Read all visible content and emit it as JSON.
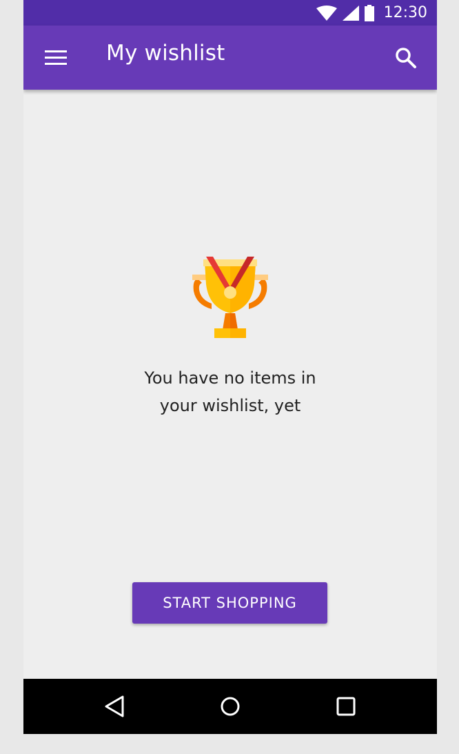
{
  "status_bar": {
    "time": "12:30",
    "icons": [
      "wifi-icon",
      "signal-icon",
      "battery-icon"
    ]
  },
  "app_bar": {
    "title": "My wishlist",
    "menu_icon": "menu-icon",
    "search_icon": "search-icon"
  },
  "empty_state": {
    "illustration": "trophy-icon",
    "line1": "You have no items in",
    "line2": "your wishlist, yet"
  },
  "actions": {
    "start_shopping_label": "START SHOPPING"
  },
  "nav_bar": {
    "icons": [
      "back-icon",
      "home-icon",
      "recents-icon"
    ]
  },
  "colors": {
    "status_bar": "#512da8",
    "primary": "#673ab7",
    "background": "#eeeeee",
    "nav_bar": "#000000",
    "text": "#212121"
  }
}
